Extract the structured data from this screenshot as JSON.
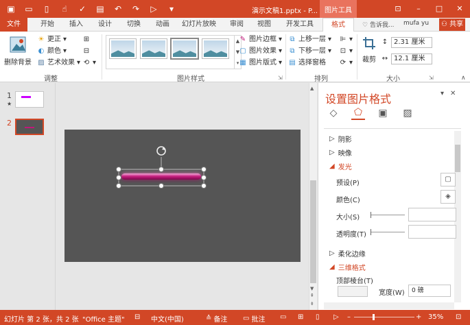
{
  "titlebar": {
    "doc_title": "演示文稿1.pptx - P...",
    "context_tab": "图片工具",
    "window_min": "–",
    "window_max": "□",
    "window_close": "✕",
    "ribbon_opts": "⊡"
  },
  "tabs": [
    {
      "label": "文件"
    },
    {
      "label": "开始"
    },
    {
      "label": "插入"
    },
    {
      "label": "设计"
    },
    {
      "label": "切换"
    },
    {
      "label": "动画"
    },
    {
      "label": "幻灯片放映"
    },
    {
      "label": "审阅"
    },
    {
      "label": "视图"
    },
    {
      "label": "开发工具"
    },
    {
      "label": "格式"
    }
  ],
  "tellme": "告诉我...",
  "user": "mufa yu",
  "share": "共享",
  "ribbon": {
    "remove_bg": "删除背景",
    "corrections": "更正",
    "color": "颜色",
    "artistic": "艺术效果",
    "group_adjust": "调整",
    "group_styles": "图片样式",
    "picture_border": "图片边框",
    "picture_effects": "图片效果",
    "picture_layout": "图片版式",
    "bring_forward": "上移一层",
    "send_backward": "下移一层",
    "selection_pane": "选择窗格",
    "group_arrange": "排列",
    "crop": "裁剪",
    "height": "2.31 厘米",
    "width": "12.1 厘米",
    "group_size": "大小"
  },
  "thumbnails": [
    {
      "num": "1",
      "star": "★"
    },
    {
      "num": "2"
    }
  ],
  "pane": {
    "title": "设置图片格式",
    "sections": {
      "shadow": "阴影",
      "reflection": "映像",
      "glow": "发光",
      "soft_edges": "柔化边缘",
      "threed_format": "三维格式"
    },
    "props": {
      "preset": "预设(P)",
      "color": "颜色(C)",
      "size": "大小(S)",
      "transparency": "透明度(T)",
      "top_bevel": "顶部棱台(T)",
      "width": "宽度(W)",
      "width_value": "0 磅"
    }
  },
  "status": {
    "slide_info": "幻灯片 第 2 张，共 2 张",
    "theme": "\"Office 主题\"",
    "language": "中文(中国)",
    "notes": "备注",
    "comments": "批注",
    "zoom": "35%"
  },
  "colors": {
    "accent": "#d24726",
    "glow_line": "#c2187a"
  }
}
